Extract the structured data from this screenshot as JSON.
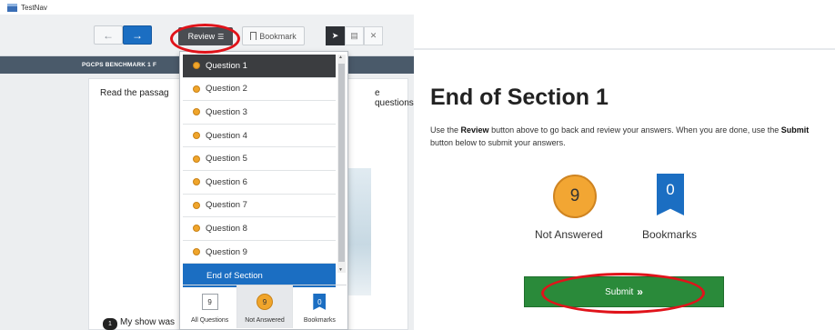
{
  "app": {
    "title": "TestNav"
  },
  "toolbar": {
    "back_icon": "arrow-left-icon",
    "next_icon": "arrow-right-icon",
    "review_label": "Review",
    "bookmark_label": "Bookmark"
  },
  "test_header": {
    "title": "PGCPS BENCHMARK 1 F"
  },
  "passage": {
    "instruction_start": "Read the passag",
    "instruction_end": "e questions.",
    "question_number": "1",
    "question_text": "My show was"
  },
  "review_dropdown": {
    "items": [
      {
        "label": "Question 1"
      },
      {
        "label": "Question 2"
      },
      {
        "label": "Question 3"
      },
      {
        "label": "Question 4"
      },
      {
        "label": "Question 5"
      },
      {
        "label": "Question 6"
      },
      {
        "label": "Question 7"
      },
      {
        "label": "Question 8"
      },
      {
        "label": "Question 9"
      }
    ],
    "end_label": "End of Section",
    "tabs": [
      {
        "label": "All Questions",
        "count": "9"
      },
      {
        "label": "Not Answered",
        "count": "9"
      },
      {
        "label": "Bookmarks",
        "count": "0"
      }
    ]
  },
  "end_section": {
    "title": "End of Section 1",
    "instr_use": "Use the ",
    "instr_review": "Review",
    "instr_mid": " button above to go back and review your answers. When you are done, use the ",
    "instr_submit": "Submit",
    "instr_end": " button below to submit your answers.",
    "not_answered_count": "9",
    "not_answered_label": "Not Answered",
    "bookmarks_count": "0",
    "bookmarks_label": "Bookmarks",
    "submit_label": "Submit",
    "submit_chevron": "»"
  },
  "colors": {
    "primary_blue": "#1b6ec2",
    "unanswered_orange": "#f2a633",
    "submit_green": "#2a8a3a",
    "highlight_red": "#e0131a"
  }
}
